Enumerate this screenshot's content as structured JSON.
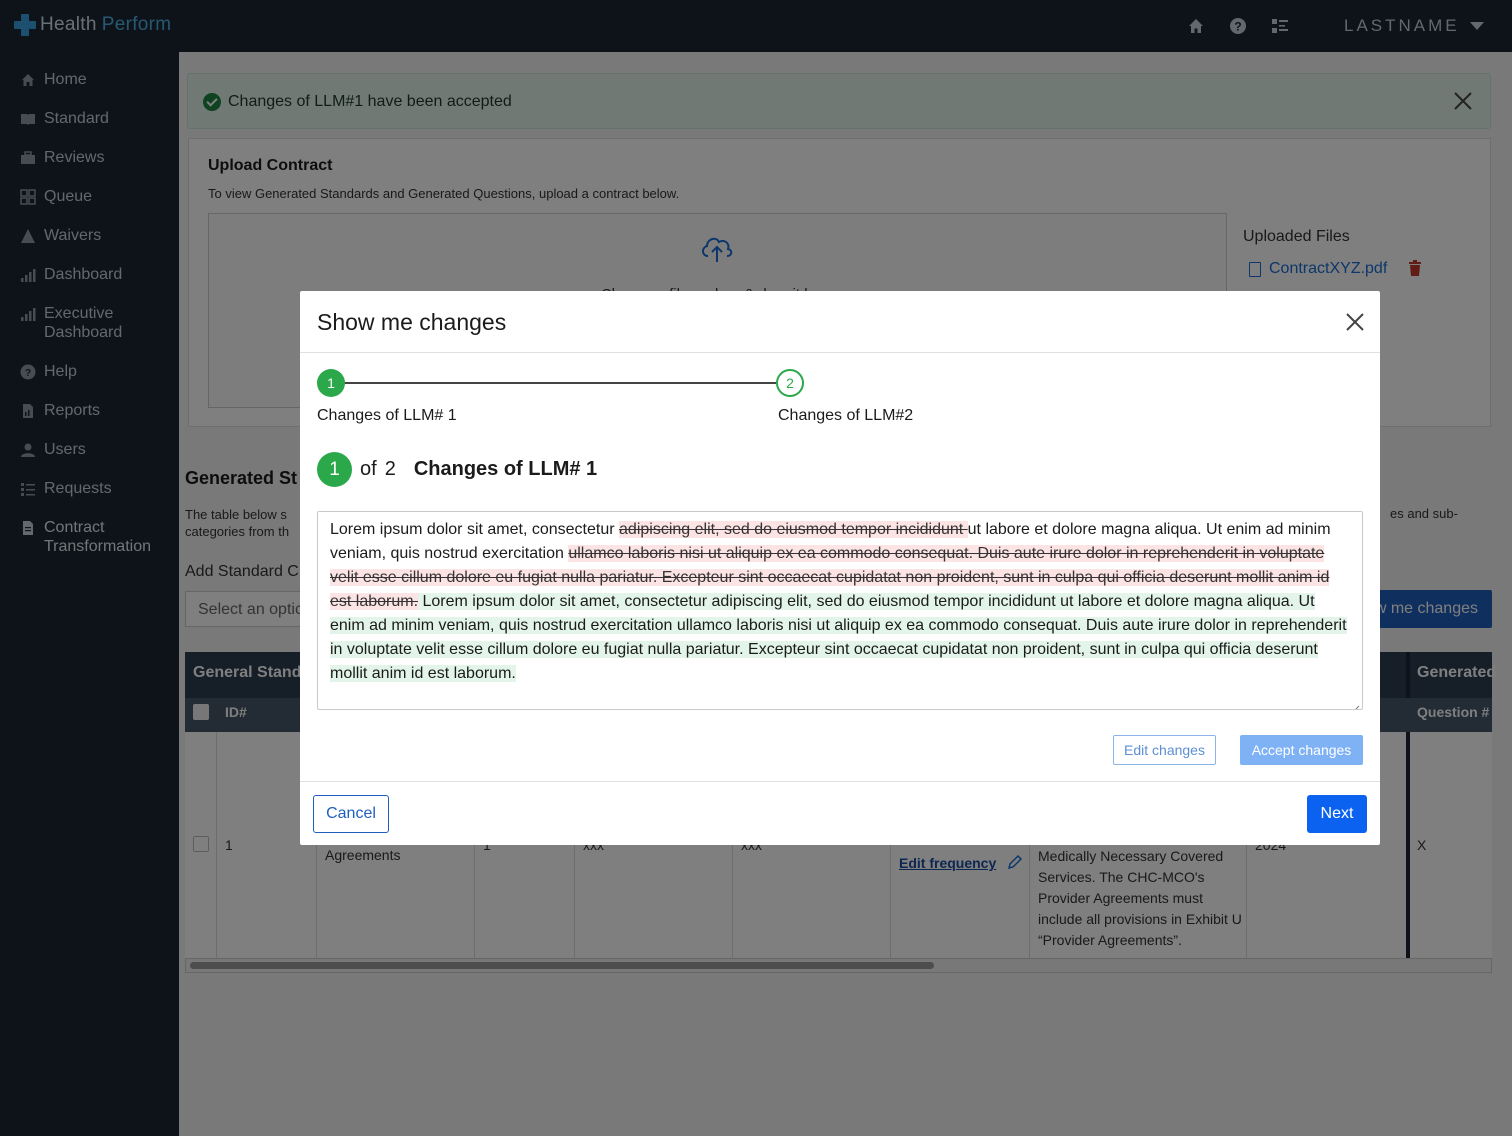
{
  "app": {
    "brand_word1": "Health",
    "brand_word2": "Perform",
    "user": "LASTNAME"
  },
  "sidebar": {
    "items": [
      {
        "label": "Home",
        "icon": "home-icon"
      },
      {
        "label": "Standard",
        "icon": "book-icon"
      },
      {
        "label": "Reviews",
        "icon": "briefcase-icon"
      },
      {
        "label": "Queue",
        "icon": "grid-icon"
      },
      {
        "label": "Waivers",
        "icon": "warning-icon"
      },
      {
        "label": "Dashboard",
        "icon": "bar-chart-icon"
      },
      {
        "label": "Executive Dashboard",
        "icon": "bar-chart-icon"
      },
      {
        "label": "Help",
        "icon": "help-icon"
      },
      {
        "label": "Reports",
        "icon": "report-icon"
      },
      {
        "label": "Users",
        "icon": "user-icon"
      },
      {
        "label": "Requests",
        "icon": "list-icon"
      },
      {
        "label": "Contract Transformation",
        "icon": "document-icon"
      }
    ]
  },
  "alert": {
    "message": "Changes of LLM#1 have been accepted"
  },
  "upload": {
    "title": "Upload Contract",
    "subtitle": "To view Generated Standards and Generated Questions, upload a contract below.",
    "drop_text": "Choose a file or drag & drop it here",
    "uploaded_label": "Uploaded Files",
    "file_name": "ContractXYZ.pdf"
  },
  "generated": {
    "title": "Generated St",
    "desc_left": "The table below s categories from th",
    "desc_right": "es and sub-",
    "add_label": "Add Standard C",
    "select_placeholder": "Select an optic",
    "show_button": "w me changes"
  },
  "table": {
    "header_left": "General Stand",
    "header_right": "Generated",
    "col_id": "ID#",
    "col_question": "Question #",
    "row": {
      "id": "1",
      "name": "Agreements",
      "num": "1",
      "v1": "xxx",
      "v2": "xxx",
      "edit_link": "Edit frequency",
      "desc": "Medically Necessary Covered Services. The CHC-MCO's Provider Agreements must include all provisions in Exhibit U “Provider Agreements”.",
      "year": "2024",
      "q": "X"
    }
  },
  "modal": {
    "title": "Show me changes",
    "step1_num": "1",
    "step2_num": "2",
    "step1_label": "Changes of LLM# 1",
    "step2_label": "Changes of LLM#2",
    "counter_current": "1",
    "counter_of": "of",
    "counter_total": "2",
    "counter_title": "Changes of LLM# 1",
    "diff": [
      {
        "type": "same",
        "text": "Lorem ipsum dolor sit amet, consectetur "
      },
      {
        "type": "del",
        "text": "adipiscing elit, sed do eiusmod tempor incididunt "
      },
      {
        "type": "same",
        "text": "ut labore et dolore magna aliqua. Ut enim ad minim veniam, quis nostrud exercitation "
      },
      {
        "type": "del",
        "text": "ullamco laboris nisi ut aliquip ex ea commodo consequat. Duis aute irure dolor in reprehenderit in voluptate velit esse cillum dolore eu fugiat nulla pariatur. Excepteur sint occaecat cupidatat non proident, sunt in culpa qui officia deserunt mollit anim id est laborum."
      },
      {
        "type": "ins",
        "text": " Lorem ipsum dolor sit amet, consectetur adipiscing elit, sed do eiusmod tempor incididunt ut labore et dolore magna aliqua. Ut enim ad minim veniam, quis nostrud exercitation ullamco laboris nisi ut aliquip ex ea commodo consequat. Duis aute irure dolor in reprehenderit in voluptate velit esse cillum dolore eu fugiat nulla pariatur. Excepteur sint occaecat cupidatat non proident, sunt in culpa qui officia deserunt mollit anim id est laborum. "
      }
    ],
    "edit_button": "Edit changes",
    "accept_button": "Accept changes",
    "cancel_button": "Cancel",
    "next_button": "Next"
  },
  "colors": {
    "success": "#2aa84a",
    "primary": "#0b62f0",
    "nav_bg": "#1c2733",
    "del_bg": "#fde4e4",
    "ins_bg": "#e3f4ea"
  }
}
